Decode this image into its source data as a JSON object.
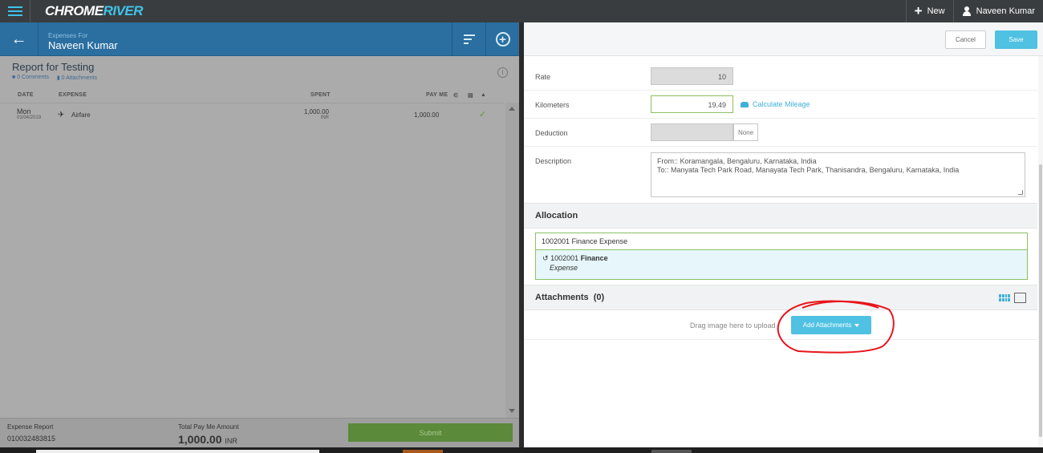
{
  "topbar": {
    "logo_part1": "CHROME",
    "logo_part2": "RIVER",
    "new_label": "New",
    "user_name": "Naveen Kumar"
  },
  "left_panel": {
    "header_sub": "Expenses For",
    "header_name": "Naveen Kumar",
    "report_title": "Report for Testing",
    "comments": "0 Comments",
    "attachments": "0 Attachments",
    "columns": {
      "date": "DATE",
      "expense": "EXPENSE",
      "spent": "SPENT",
      "pay_me": "PAY ME"
    },
    "rows": [
      {
        "day": "Mon",
        "date": "01/04/2019",
        "expense": "Airfare",
        "spent": "1,000.00",
        "currency": "INR",
        "pay_me": "1,000.00"
      }
    ],
    "footer": {
      "report_label": "Expense Report",
      "report_number": "010032483815",
      "total_label": "Total Pay Me Amount",
      "total_value": "1,000.00",
      "total_currency": "INR",
      "submit_label": "Submit"
    }
  },
  "right_panel": {
    "cancel_label": "Cancel",
    "save_label": "Save",
    "rate_label": "Rate",
    "rate_value": "10",
    "km_label": "Kilometers",
    "km_value": "19.49",
    "calc_label": "Calculate Mileage",
    "deduction_label": "Deduction",
    "deduction_option": "None",
    "description_label": "Description",
    "description_line1": "From:: Koramangala, Bengaluru, Karnataka, India",
    "description_line2": "To:: Manyata Tech Park Road, Manayata Tech Park, Thanisandra, Bengaluru, Karnataka, India",
    "allocation_title": "Allocation",
    "allocation_value": "1002001 Finance Expense",
    "suggestion_code": "1002001",
    "suggestion_name": "Finance",
    "suggestion_sub": "Expense",
    "attachments_title": "Attachments",
    "attachments_count": "(0)",
    "drop_text": "Drag image here to upload",
    "add_attachments_label": "Add Attachments"
  },
  "colors": {
    "brand_blue": "#2a6fa0",
    "accent_cyan": "#4fc1e2",
    "submit_green": "#5b8a3a",
    "annotation_red": "#e8141b"
  }
}
